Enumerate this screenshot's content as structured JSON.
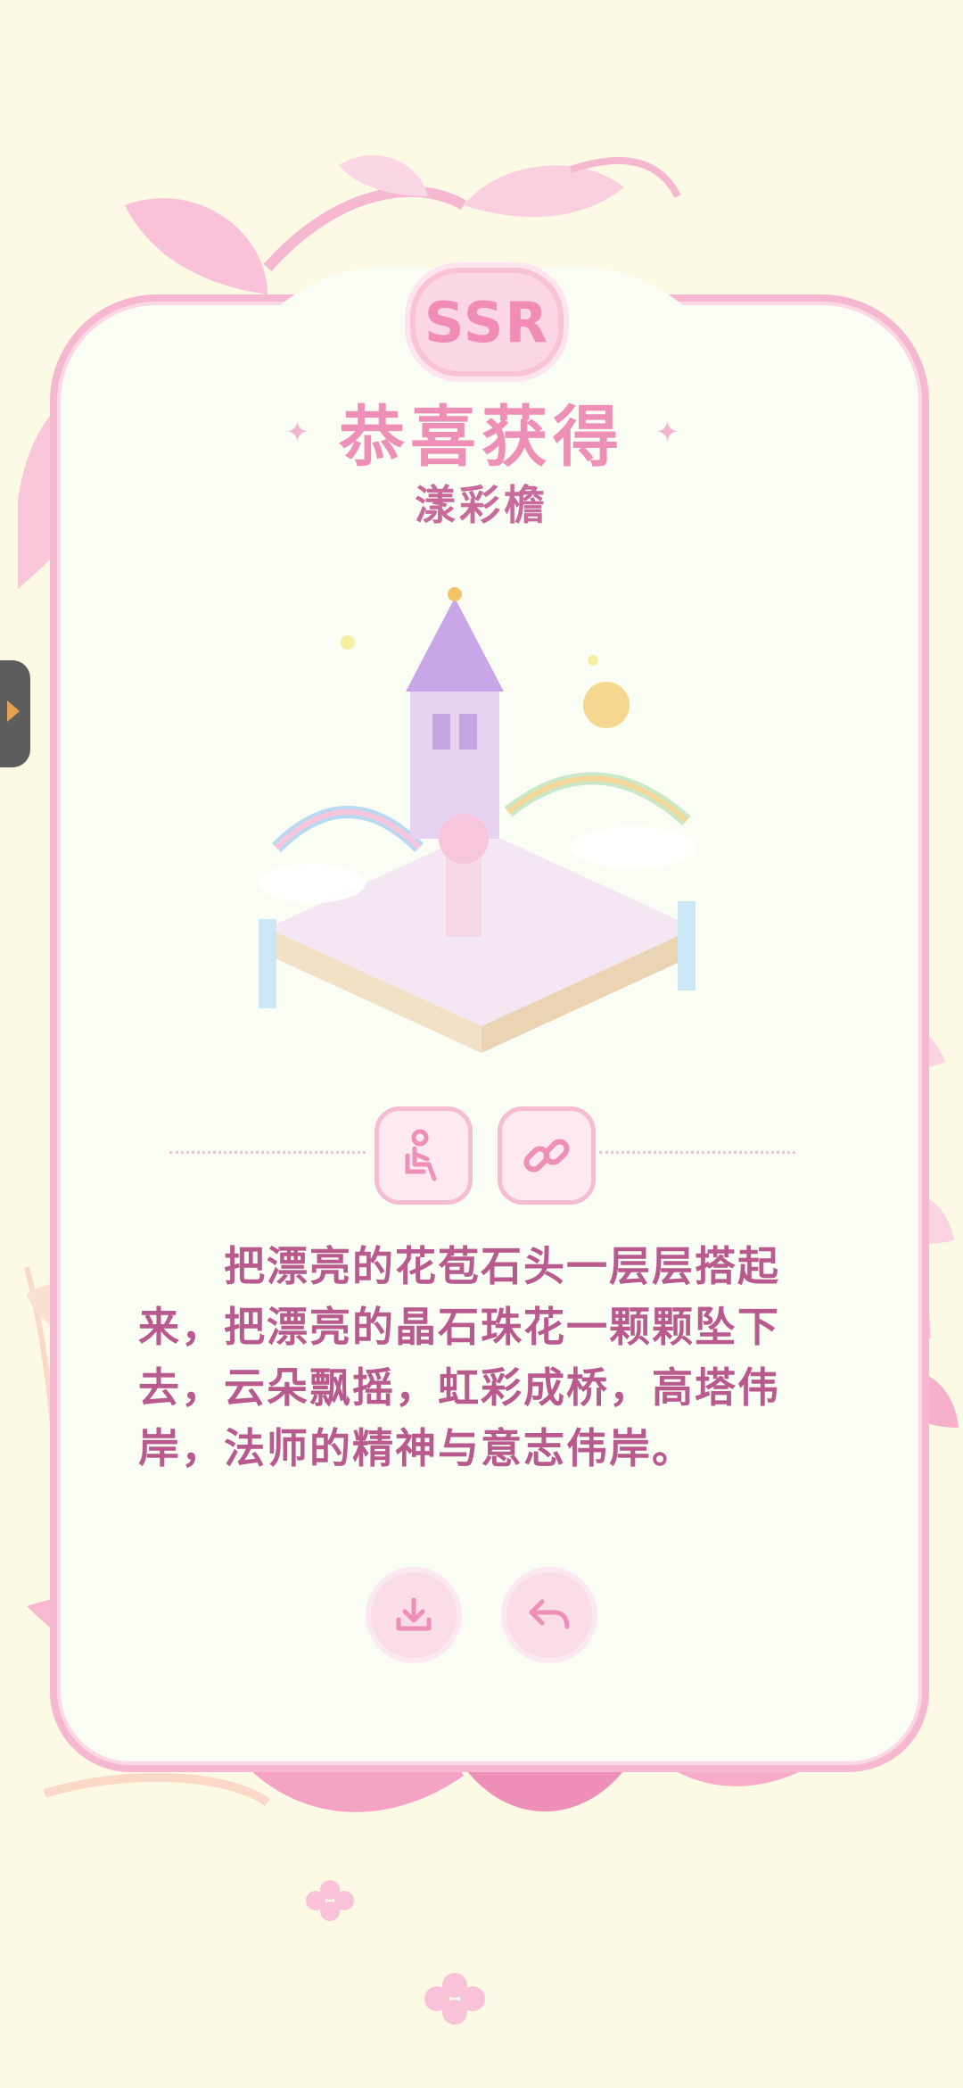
{
  "badge": {
    "label": "SSR"
  },
  "header": {
    "title": "恭喜获得",
    "item_name": "漾彩檐"
  },
  "item": {
    "image": "castle-illustration"
  },
  "actions": {
    "pose_icon": "sitting-person-icon",
    "link_icon": "link-icon",
    "download_icon": "download-icon",
    "return_icon": "return-icon"
  },
  "description": "　　把漂亮的花苞石头一层层搭起来，把漂亮的晶石珠花一颗颗坠下去，云朵飘摇，虹彩成桥，高塔伟岸，法师的精神与意志伟岸。",
  "theme": {
    "accent": "#EE8FB8",
    "text": "#B85A8E",
    "background": "#FCFAE4"
  }
}
